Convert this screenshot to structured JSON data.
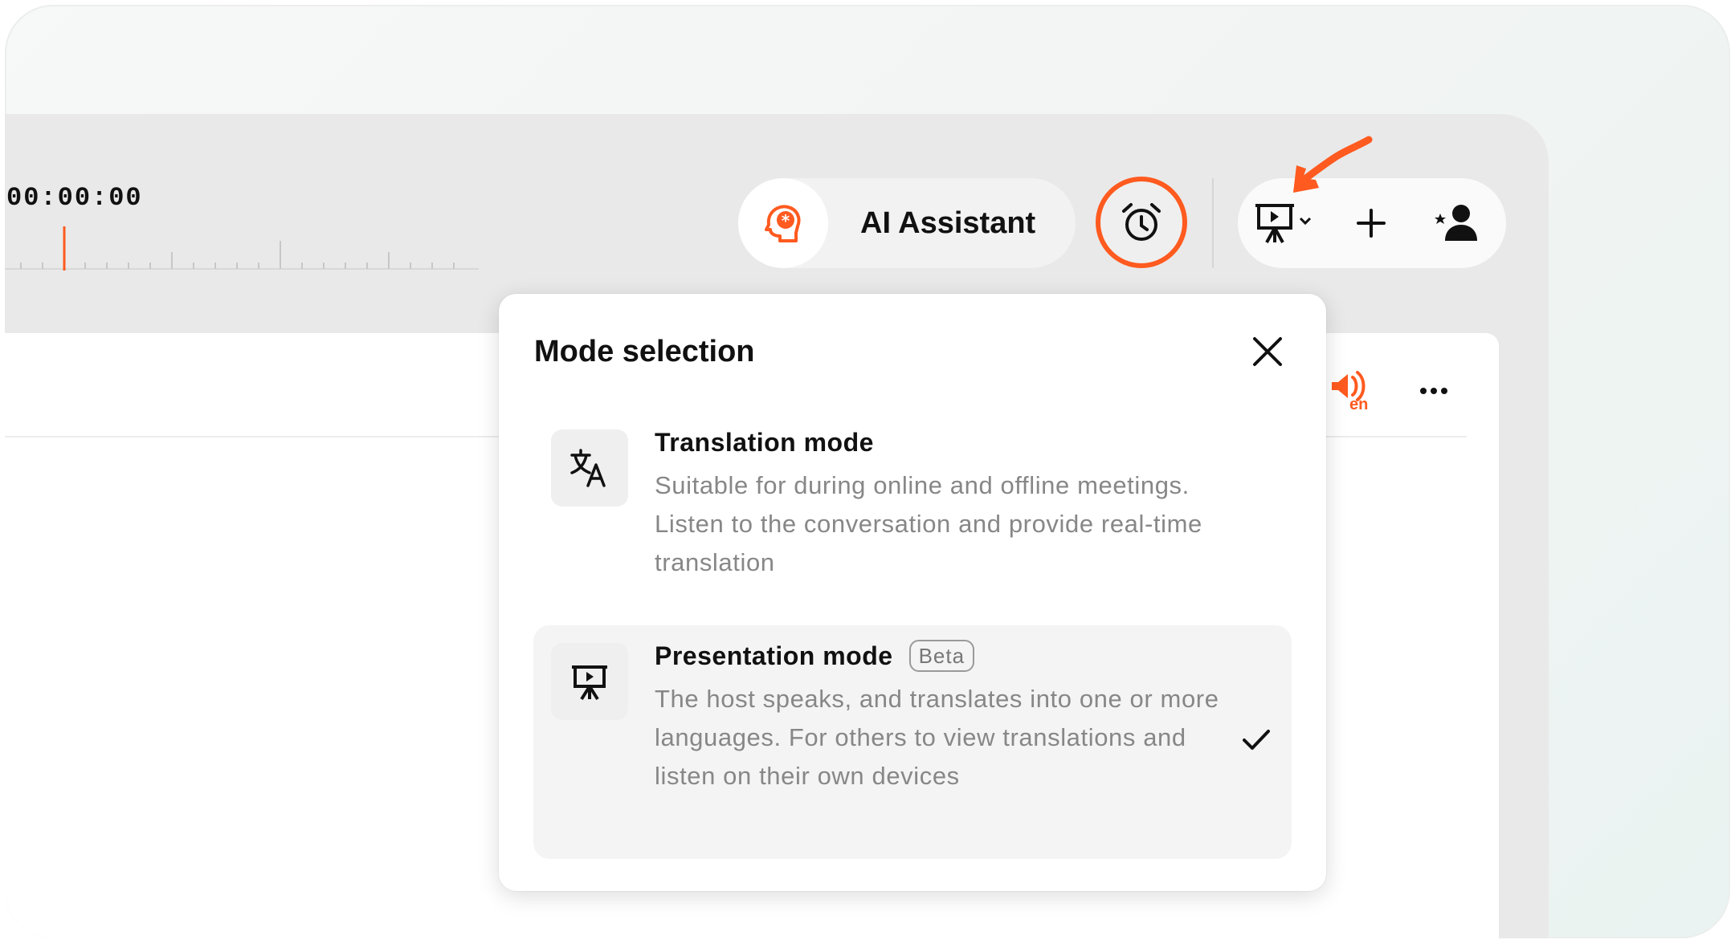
{
  "toolbar": {
    "timecode": "00:00:00",
    "ai_assistant_label": "AI Assistant"
  },
  "popover": {
    "title": "Mode selection",
    "modes": [
      {
        "name": "Translation mode",
        "description": "Suitable for during online and offline meetings. Listen to the conversation and provide real-time translation",
        "icon": "translate-icon",
        "selected": false
      },
      {
        "name": "Presentation mode",
        "badge": "Beta",
        "description": "The host speaks, and translates into one or more languages. For others to view translations and listen on their own devices",
        "icon": "presentation-icon",
        "selected": true
      }
    ]
  },
  "panel": {
    "speaker_language": "en"
  },
  "colors": {
    "accent": "#ff5a1f",
    "muted_text": "#878787"
  }
}
